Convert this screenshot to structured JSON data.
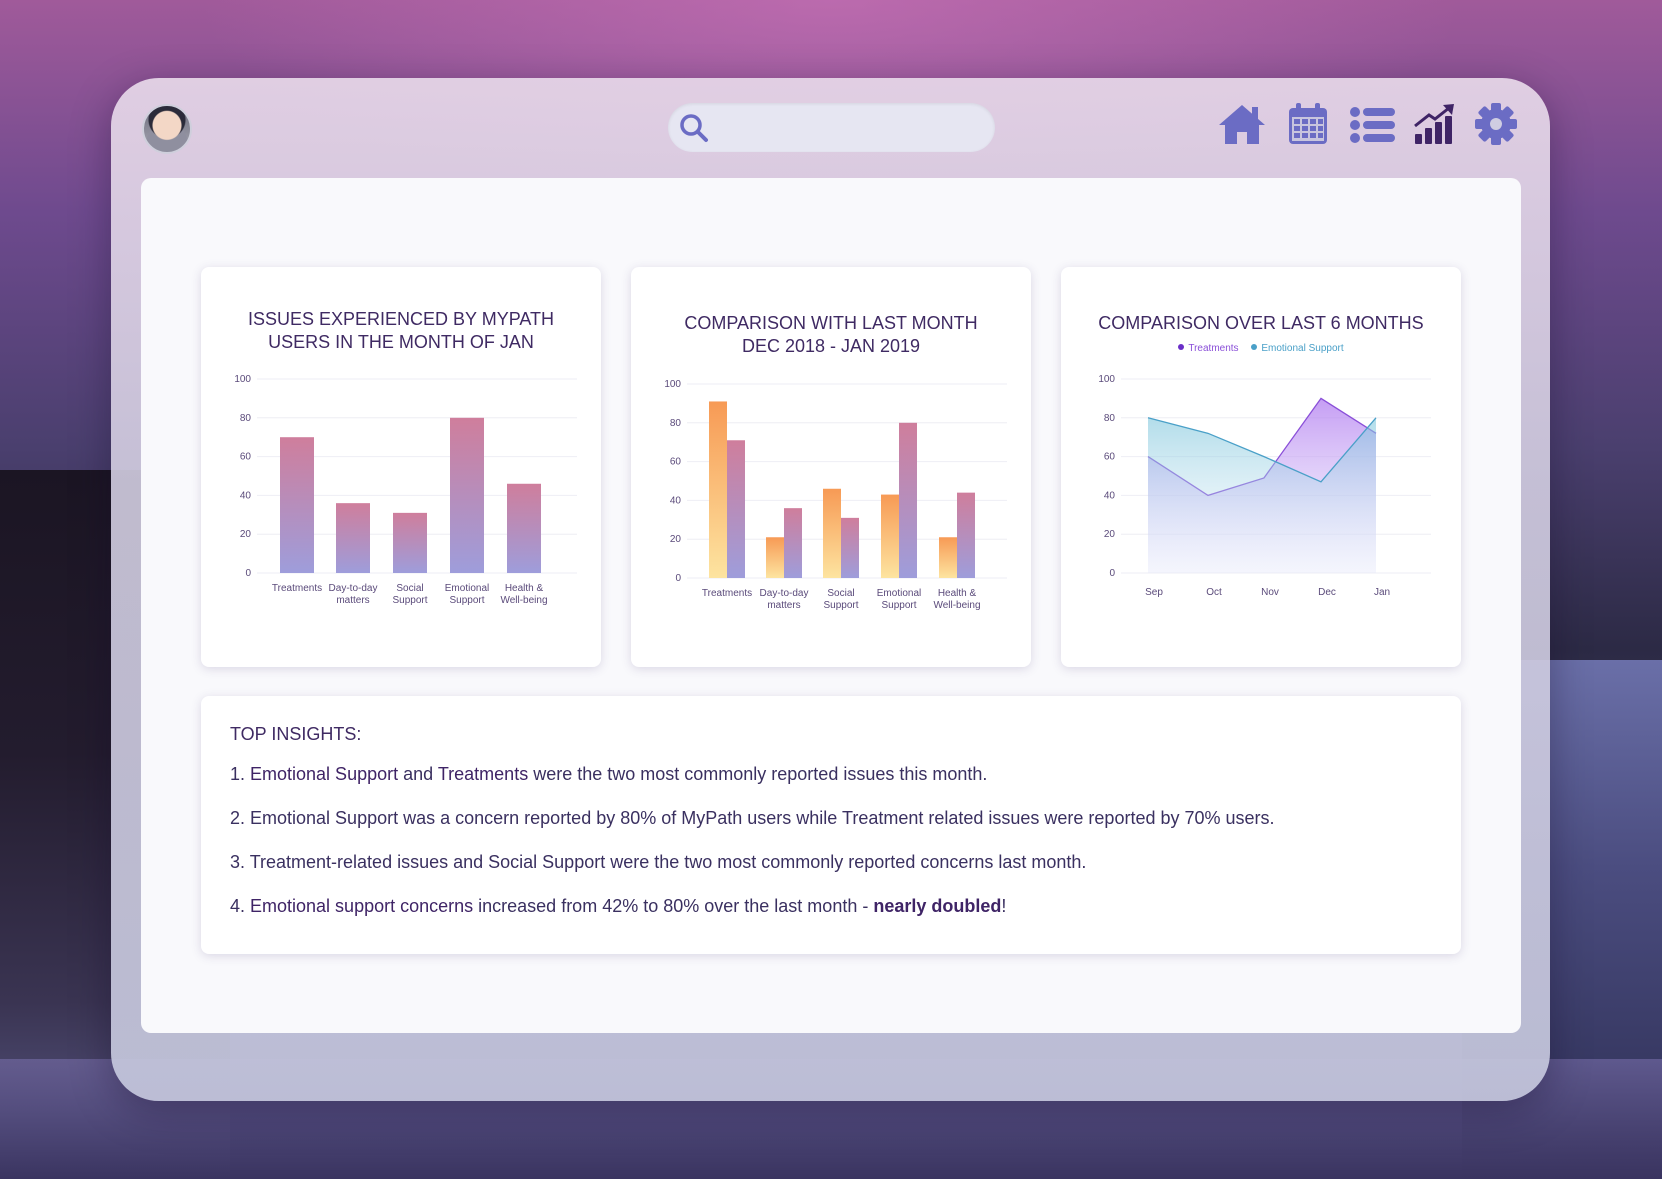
{
  "search": {
    "placeholder": ""
  },
  "nav": {
    "items": [
      "home-icon",
      "calendar-icon",
      "list-icon",
      "chart-icon",
      "gear-icon"
    ],
    "accent": "#6b6cc4",
    "active": "#3f2466"
  },
  "charts": {
    "chart1": {
      "title_line1": "ISSUES EXPERIENCED BY MYPATH",
      "title_line2": "USERS IN THE MONTH OF JAN"
    },
    "chart2": {
      "title_line1": "COMPARISON WITH LAST MONTH",
      "title_line2": "DEC 2018 - JAN 2019"
    },
    "chart3": {
      "title_line1": "COMPARISON OVER LAST 6 MONTHS"
    }
  },
  "chart_data": [
    {
      "type": "bar",
      "categories": [
        [
          "Treatments"
        ],
        [
          "Day-to-day",
          "matters"
        ],
        [
          "Social",
          "Support"
        ],
        [
          "Emotional",
          "Support"
        ],
        [
          "Health &",
          "Well-being"
        ]
      ],
      "values": [
        70,
        36,
        31,
        80,
        46
      ],
      "ylim": [
        0,
        100
      ],
      "yticks": [
        0,
        20,
        40,
        60,
        80,
        100
      ],
      "colors": {
        "top": "#cf7e9c",
        "bottom": "#9e9ddb"
      }
    },
    {
      "type": "bar",
      "categories": [
        [
          "Treatments"
        ],
        [
          "Day-to-day",
          "matters"
        ],
        [
          "Social",
          "Support"
        ],
        [
          "Emotional",
          "Support"
        ],
        [
          "Health &",
          "Well-being"
        ]
      ],
      "series": [
        {
          "values": [
            91,
            21,
            46,
            43,
            21
          ],
          "colors": {
            "top": "#f79a55",
            "bottom": "#fde4a0"
          }
        },
        {
          "values": [
            71,
            36,
            31,
            80,
            44
          ],
          "colors": {
            "top": "#cf7e9c",
            "bottom": "#9e9ddb"
          }
        }
      ],
      "ylim": [
        0,
        100
      ],
      "yticks": [
        0,
        20,
        40,
        60,
        80,
        100
      ]
    },
    {
      "type": "area",
      "x": [
        "Sep",
        "Oct",
        "Nov",
        "Dec",
        "Jan"
      ],
      "series": [
        {
          "name": "Treatments",
          "values": [
            60,
            40,
            49,
            90,
            72
          ],
          "color": "#8a4fd8"
        },
        {
          "name": "Emotional Support",
          "values": [
            80,
            72,
            60,
            47,
            80
          ],
          "color": "#4aa0c8"
        }
      ],
      "ylim": [
        0,
        100
      ],
      "yticks": [
        0,
        20,
        40,
        60,
        80,
        100
      ],
      "legend": "top-center"
    }
  ],
  "insights": {
    "title": "TOP INSIGHTS:",
    "i1": {
      "num": "1. ",
      "a": "Emotional Support",
      "b": " and ",
      "c": "Treatments",
      "d": " were the two most commonly reported issues this month."
    },
    "i2": {
      "text": "2. Emotional Support was a concern reported by 80% of MyPath users while Treatment related issues were reported by 70% users."
    },
    "i3": {
      "text": "3. Treatment-related issues and Social Support were the two most commonly reported concerns last month."
    },
    "i4": {
      "num": "4. ",
      "a": "Emotional support concerns",
      "b": " increased from 42% to 80% over the last month - ",
      "c": "nearly doubled",
      "d": "!"
    }
  }
}
